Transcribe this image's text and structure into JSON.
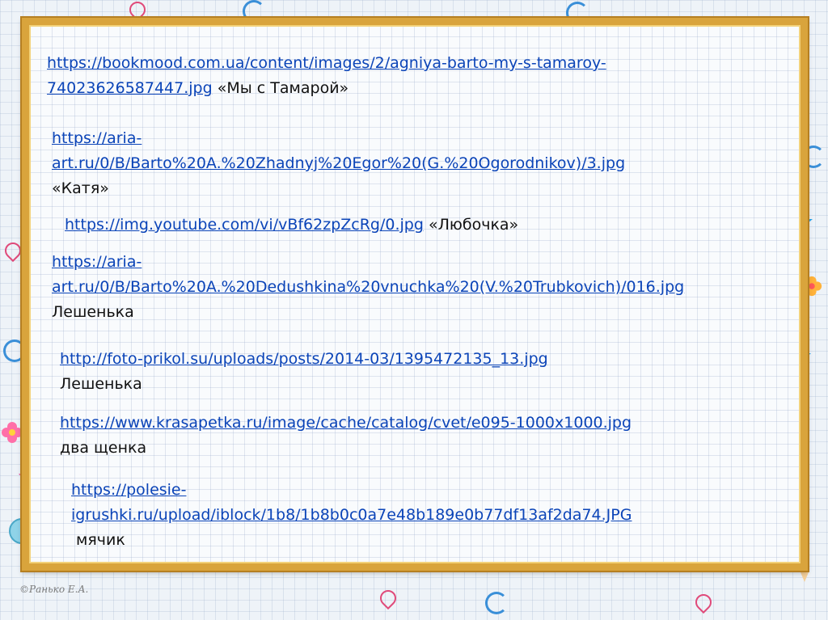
{
  "entries": [
    {
      "url": "https://bookmood.com.ua/content/images/2/agniya-barto-my-s-tamaroy-74023626587447.jpg",
      "url_line1": "https://bookmood.com.ua/content/images/2/agniya-barto-my-s-tamaroy-",
      "url_line2": "74023626587447.jpg",
      "caption": "«Мы с Тамарой»"
    },
    {
      "url_line1": "https://aria-",
      "url_line2": "art.ru/0/B/Barto%20A.%20Zhadnyj%20Egor%20(G.%20Ogorodnikov)/3.jpg",
      "caption": "«Катя»"
    },
    {
      "url_line1": "https://img.youtube.com/vi/vBf62zpZcRg/0.jpg",
      "caption": "«Любочка»"
    },
    {
      "url_line1": "https://aria-",
      "url_line2": "art.ru/0/B/Barto%20A.%20Dedushkina%20vnuchka%20(V.%20Trubkovich)/016.jpg",
      "caption": "Лешенька"
    },
    {
      "url_line1": "http://foto-prikol.su/uploads/posts/2014-03/1395472135_13.jpg",
      "caption": "Лешенька"
    },
    {
      "url_line1": "https://www.krasapetka.ru/image/cache/catalog/cvet/e095-1000x1000.jpg",
      "caption": "два щенка"
    },
    {
      "url_line1": "https://polesie-",
      "url_line2": "igrushki.ru/upload/iblock/1b8/1b8b0c0a7e48b189e0b77df13af2da74.JPG",
      "caption": "мячик"
    }
  ],
  "credit": "©Ранько Е.А.",
  "colors": {
    "link": "#0b44b8",
    "frame": "#d9a43c",
    "text": "#111111"
  }
}
